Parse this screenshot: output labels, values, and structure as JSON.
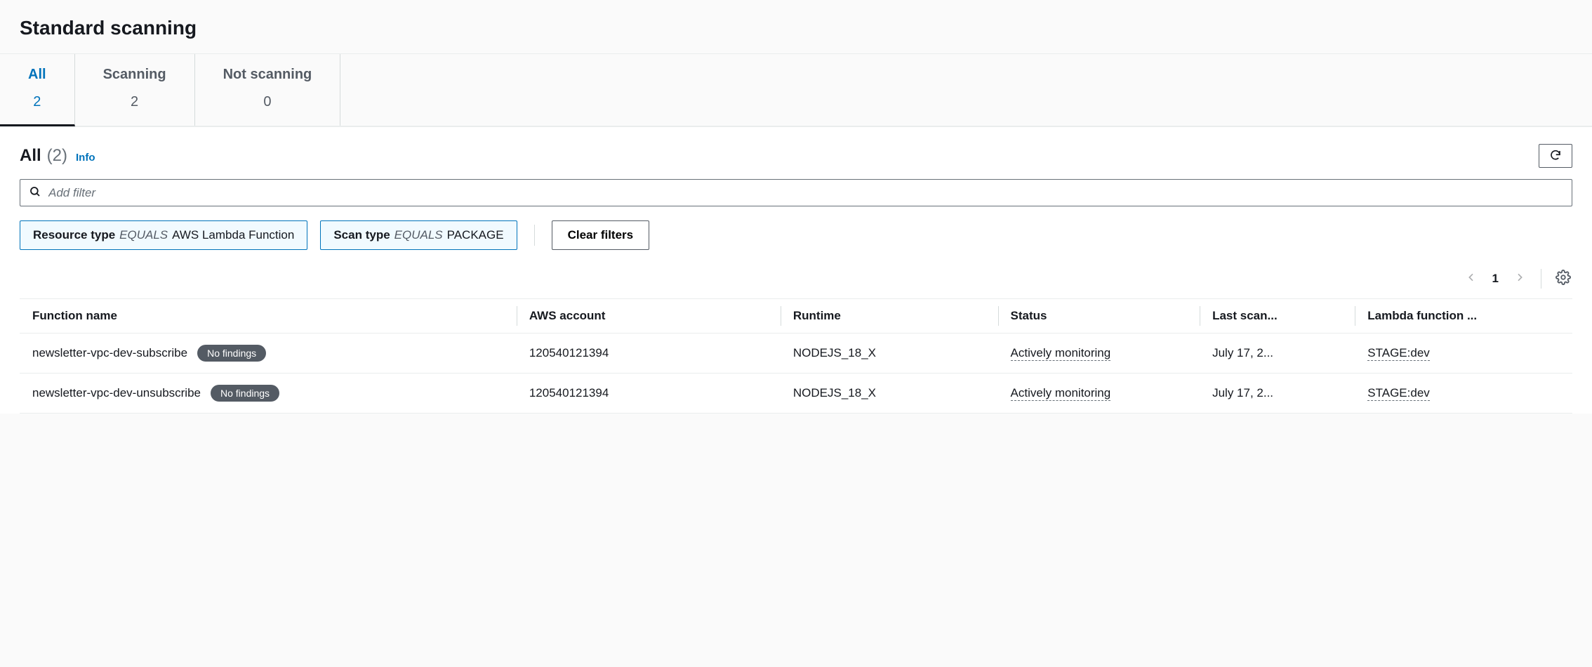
{
  "page": {
    "title": "Standard scanning"
  },
  "tabs": [
    {
      "label": "All",
      "count": "2",
      "active": true
    },
    {
      "label": "Scanning",
      "count": "2",
      "active": false
    },
    {
      "label": "Not scanning",
      "count": "0",
      "active": false
    }
  ],
  "section": {
    "title": "All",
    "count": "(2)",
    "info": "Info"
  },
  "filter": {
    "placeholder": "Add filter"
  },
  "chips": [
    {
      "key": "Resource type",
      "op": "EQUALS",
      "value": "AWS Lambda Function"
    },
    {
      "key": "Scan type",
      "op": "EQUALS",
      "value": "PACKAGE"
    }
  ],
  "clear_label": "Clear filters",
  "pagination": {
    "current": "1"
  },
  "columns": {
    "fn": "Function name",
    "acct": "AWS account",
    "rt": "Runtime",
    "st": "Status",
    "ls": "Last scan...",
    "tag": "Lambda function ..."
  },
  "rows": [
    {
      "fn": "newsletter-vpc-dev-subscribe",
      "badge": "No findings",
      "acct": "120540121394",
      "rt": "NODEJS_18_X",
      "st": "Actively monitoring",
      "ls": "July 17, 2...",
      "tag": "STAGE:dev"
    },
    {
      "fn": "newsletter-vpc-dev-unsubscribe",
      "badge": "No findings",
      "acct": "120540121394",
      "rt": "NODEJS_18_X",
      "st": "Actively monitoring",
      "ls": "July 17, 2...",
      "tag": "STAGE:dev"
    }
  ]
}
